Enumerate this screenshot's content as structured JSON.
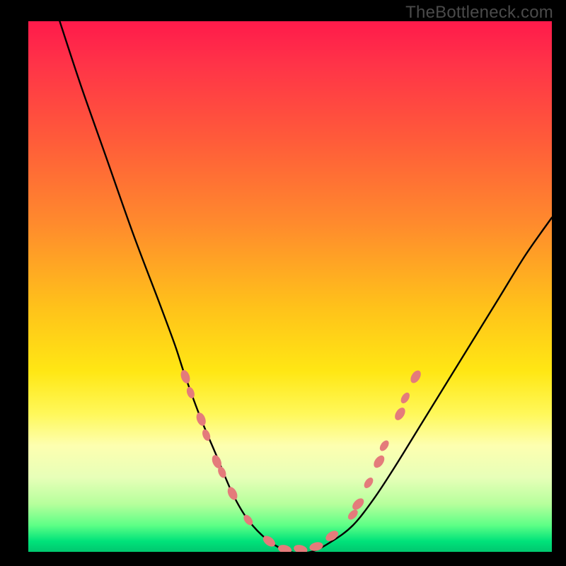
{
  "watermark": "TheBottleneck.com",
  "chart_data": {
    "type": "line",
    "title": "",
    "xlabel": "",
    "ylabel": "",
    "xlim": [
      0,
      100
    ],
    "ylim": [
      0,
      100
    ],
    "series": [
      {
        "name": "bottleneck-curve",
        "x": [
          6,
          10,
          15,
          20,
          25,
          28,
          30,
          33,
          36,
          39,
          42,
          46,
          50,
          54,
          58,
          62,
          66,
          70,
          75,
          80,
          85,
          90,
          95,
          100
        ],
        "y": [
          100,
          88,
          74,
          60,
          47,
          39,
          33,
          25,
          18,
          11,
          6,
          2,
          0,
          0,
          2,
          5,
          10,
          16,
          24,
          32,
          40,
          48,
          56,
          63
        ]
      }
    ],
    "markers": {
      "name": "sample-points",
      "color": "#e47b7b",
      "points": [
        {
          "x": 30,
          "y": 33,
          "r": 1.4
        },
        {
          "x": 31,
          "y": 30,
          "r": 1.2
        },
        {
          "x": 33,
          "y": 25,
          "r": 1.4
        },
        {
          "x": 34,
          "y": 22,
          "r": 1.2
        },
        {
          "x": 36,
          "y": 17,
          "r": 1.4
        },
        {
          "x": 37,
          "y": 15,
          "r": 1.2
        },
        {
          "x": 39,
          "y": 11,
          "r": 1.4
        },
        {
          "x": 42,
          "y": 6,
          "r": 1.2
        },
        {
          "x": 46,
          "y": 2,
          "r": 1.4
        },
        {
          "x": 49,
          "y": 0.5,
          "r": 1.4
        },
        {
          "x": 52,
          "y": 0.5,
          "r": 1.4
        },
        {
          "x": 55,
          "y": 1,
          "r": 1.4
        },
        {
          "x": 58,
          "y": 3,
          "r": 1.4
        },
        {
          "x": 62,
          "y": 7,
          "r": 1.2
        },
        {
          "x": 63,
          "y": 9,
          "r": 1.4
        },
        {
          "x": 65,
          "y": 13,
          "r": 1.2
        },
        {
          "x": 67,
          "y": 17,
          "r": 1.4
        },
        {
          "x": 68,
          "y": 20,
          "r": 1.2
        },
        {
          "x": 71,
          "y": 26,
          "r": 1.4
        },
        {
          "x": 72,
          "y": 29,
          "r": 1.2
        },
        {
          "x": 74,
          "y": 33,
          "r": 1.4
        }
      ]
    },
    "gradient_stops": [
      {
        "pos": 0.0,
        "color": "#ff1a4b"
      },
      {
        "pos": 0.08,
        "color": "#ff3348"
      },
      {
        "pos": 0.22,
        "color": "#ff5a3a"
      },
      {
        "pos": 0.38,
        "color": "#ff8a2d"
      },
      {
        "pos": 0.54,
        "color": "#ffc21a"
      },
      {
        "pos": 0.66,
        "color": "#ffe714"
      },
      {
        "pos": 0.74,
        "color": "#fff85a"
      },
      {
        "pos": 0.8,
        "color": "#fdffb0"
      },
      {
        "pos": 0.86,
        "color": "#e7ffb8"
      },
      {
        "pos": 0.91,
        "color": "#b6ff9c"
      },
      {
        "pos": 0.95,
        "color": "#5dff86"
      },
      {
        "pos": 0.98,
        "color": "#00e27a"
      },
      {
        "pos": 1.0,
        "color": "#00c76f"
      }
    ]
  }
}
